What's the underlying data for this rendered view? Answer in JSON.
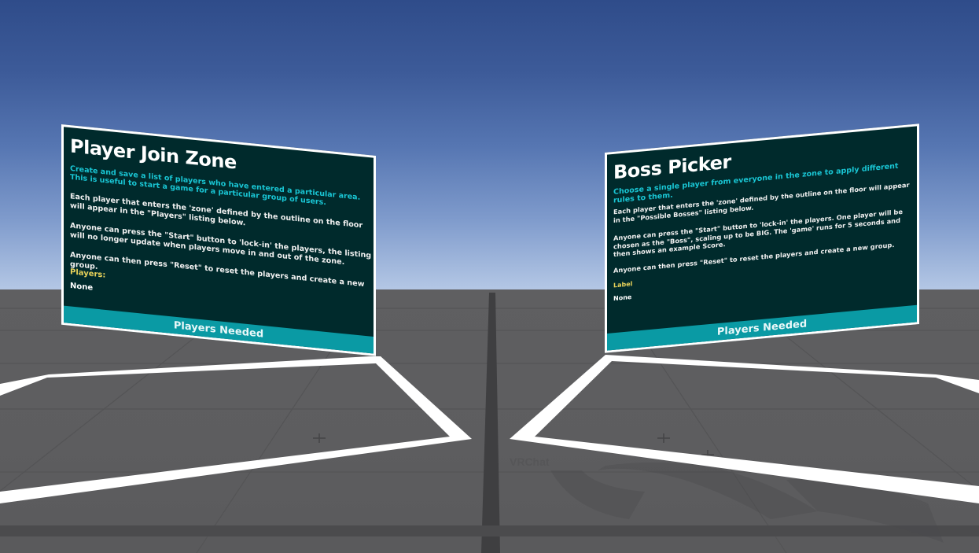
{
  "scene": {
    "sky_top": "#2f4c8a",
    "sky_horizon": "#b6c9e6",
    "floor_color": "#5f5f61",
    "zone_outline_color": "#ffffff",
    "floor_logo_text": "VRChat"
  },
  "join_zone": {
    "title": "Player Join Zone",
    "subtitle": "Create and save a list of players who have entered a particular area. This is useful to start a game for a particular group of users.",
    "para1": "Each player that enters the 'zone' defined by the outline on the floor will appear in the \"Players\" listing below.",
    "para2": "Anyone can press the \"Start\" button to 'lock-in' the players, the listing will no longer update when players move in and out of the zone.",
    "para3": "Anyone can then press \"Reset\" to reset the players and create a new group.",
    "players_label": "Players:",
    "players_value": "None",
    "footer": "Players Needed"
  },
  "boss_picker": {
    "title": "Boss Picker",
    "subtitle": "Choose a single player from everyone in the zone to apply different rules to them.",
    "para1": "Each player that enters the 'zone' defined by the outline on the floor will appear in the \"Possible Bosses\" listing below.",
    "para2": "Anyone can press the \"Start\" button to 'lock-in' the players. One player will be chosen as the \"Boss\", scaling up to be BIG. The 'game' runs for 5 seconds and then shows an example Score.",
    "para3": "Anyone can then press \"Reset\" to reset the players and create a new group.",
    "label": "Label",
    "value": "None",
    "footer": "Players Needed"
  }
}
